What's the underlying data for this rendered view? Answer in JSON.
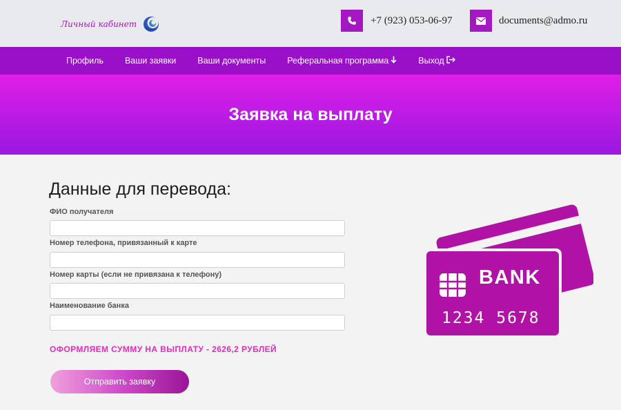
{
  "header": {
    "logo_text": "Личный кабинет",
    "phone": "+7 (923) 053-06-97",
    "email": "documents@admo.ru"
  },
  "nav": {
    "items": [
      {
        "label": "Профиль"
      },
      {
        "label": "Ваши заявки"
      },
      {
        "label": "Ваши документы"
      },
      {
        "label": "Реферальная программа",
        "icon": "arrow-down-icon",
        "glyph": "🡓"
      },
      {
        "label": "Выход",
        "icon": "sign-out-icon",
        "glyph": "⇥"
      }
    ]
  },
  "hero": {
    "title": "Заявка на выплату"
  },
  "form": {
    "title": "Данные для перевода:",
    "fields": [
      {
        "label": "ФИО получателя",
        "value": ""
      },
      {
        "label": "Номер телефона, привязанный к карте",
        "value": ""
      },
      {
        "label": "Номер карты (если не привязана к телефону)",
        "value": ""
      },
      {
        "label": "Наименование банка",
        "value": ""
      }
    ],
    "sum_text": "ОФОРМЛЯЕМ СУММУ НА ВЫПЛАТУ - 2626,2 РУБЛЕЙ",
    "submit_label": "Отправить заявку"
  },
  "card": {
    "bank_text": "BANK",
    "number": "1234 5678"
  },
  "colors": {
    "accent": "#a418c2",
    "nav_bg": "#9a10c9",
    "hero_top": "#e01fe6",
    "hero_bottom": "#9a18e0",
    "sum_text": "#e629c0",
    "card": "#b012a6"
  }
}
